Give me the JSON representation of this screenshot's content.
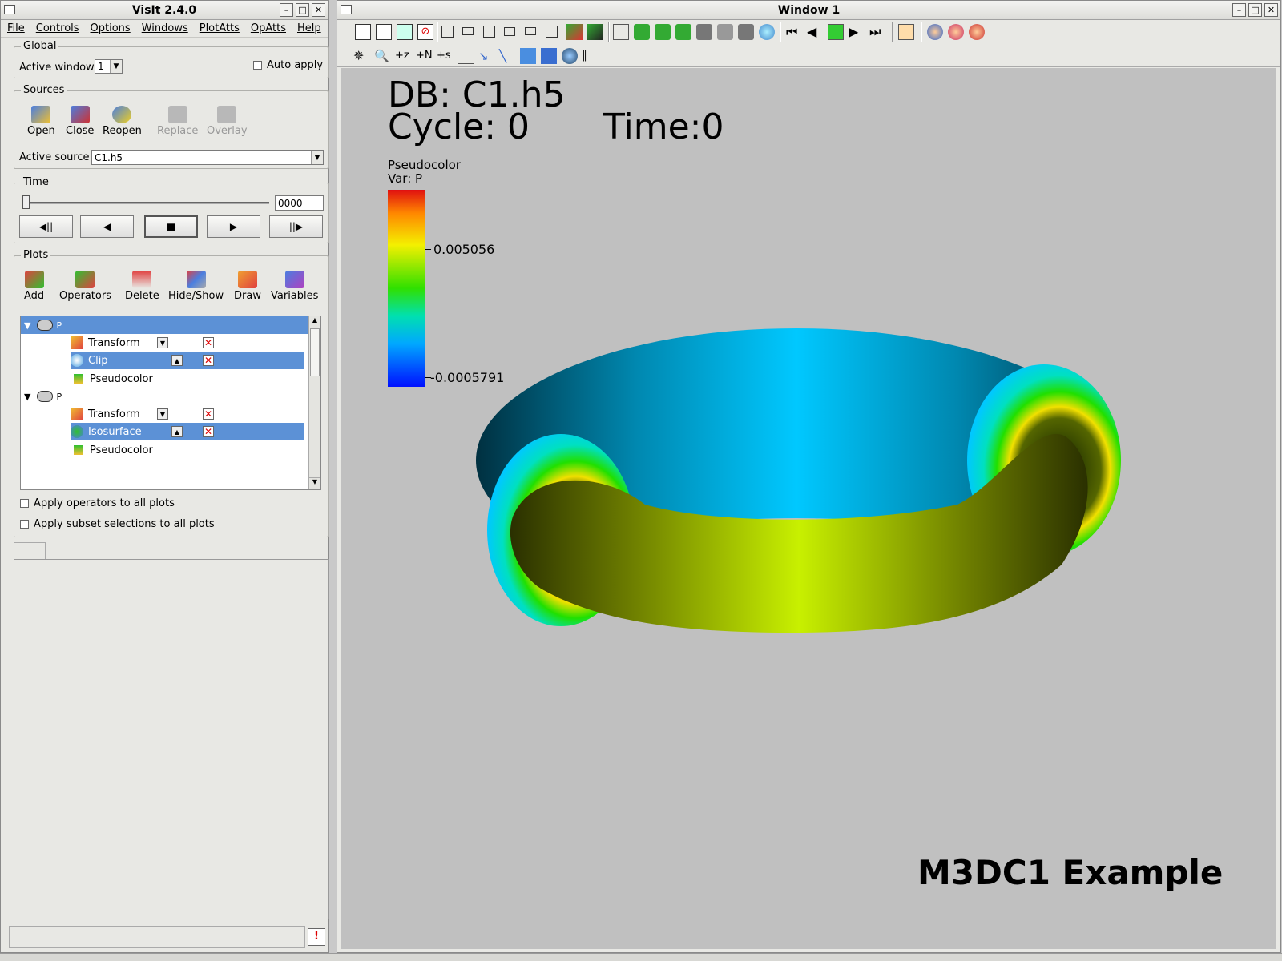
{
  "gui": {
    "title": "VisIt 2.4.0",
    "menu": [
      "File",
      "Controls",
      "Options",
      "Windows",
      "PlotAtts",
      "OpAtts",
      "Help"
    ],
    "global": {
      "label": "Global",
      "active_window_label": "Active window",
      "active_window_value": "1",
      "auto_apply": "Auto apply"
    },
    "sources": {
      "label": "Sources",
      "buttons": [
        "Open",
        "Close",
        "Reopen",
        "Replace",
        "Overlay"
      ],
      "active_source_label": "Active source",
      "active_source_value": "C1.h5"
    },
    "time": {
      "label": "Time",
      "value": "0000",
      "buttons": [
        "◀||",
        "◀",
        "■",
        "▶",
        "||▶"
      ]
    },
    "plots": {
      "label": "Plots",
      "buttons": [
        "Add",
        "Operators",
        "Delete",
        "Hide/Show",
        "Draw",
        "Variables"
      ],
      "items": [
        {
          "name": "P",
          "ops": [
            "Transform",
            "Clip",
            "Pseudocolor"
          ]
        },
        {
          "name": "P",
          "ops": [
            "Transform",
            "Isosurface",
            "Pseudocolor"
          ]
        }
      ]
    },
    "apply_ops": "Apply operators to all plots",
    "apply_subset": "Apply subset selections to all plots"
  },
  "viewer": {
    "title": "Window 1",
    "db": "DB: C1.h5",
    "cycle": "Cycle: 0",
    "time": "Time:0",
    "legend": {
      "title": "Pseudocolor",
      "var": "Var: P",
      "max": "0.005056",
      "min": "-0.0005791"
    },
    "caption": "M3DC1 Example"
  },
  "colors": {
    "selection": "#5c91d6",
    "viewport": "#c0c0c0",
    "torus_outer": "#00bfff",
    "torus_inner": "#b8e800"
  }
}
